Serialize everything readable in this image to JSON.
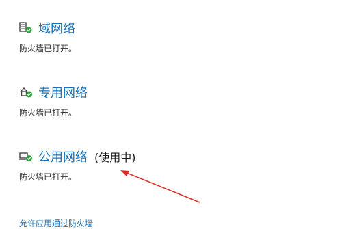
{
  "sections": [
    {
      "title": "域网络",
      "status": "防火墙已打开。",
      "icon": "domain-network-shield-icon"
    },
    {
      "title": "专用网络",
      "status": "防火墙已打开。",
      "icon": "private-network-shield-icon"
    },
    {
      "title": "公用网络",
      "badge": "(使用中)",
      "status": "防火墙已打开。",
      "icon": "public-network-shield-icon"
    }
  ],
  "links": {
    "allow_app": "允许应用通过防火墙"
  },
  "colors": {
    "link": "#1a73b8",
    "shield_green": "#2aa33a",
    "annotation_arrow": "#d93025"
  },
  "annotation": {
    "type": "arrow",
    "points_to": "public-network-in-use-label"
  }
}
